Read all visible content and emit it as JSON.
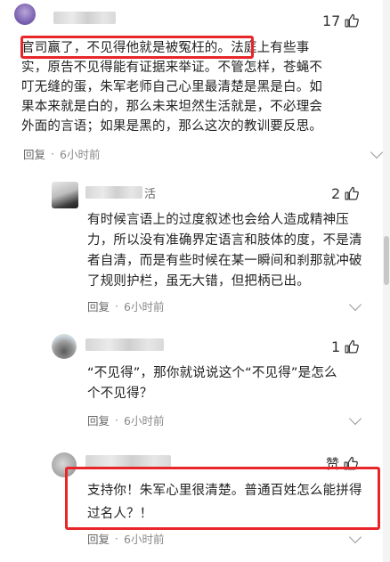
{
  "comments": [
    {
      "likes": "17",
      "text_lines": [
        "官司赢了，不见得他就是被冤枉的。法庭上有些事",
        "实，原告不见得能有证据来举证。不管怎样，苍蝇不",
        "叮无缝的蛋，朱军老师自己心里最清楚是黑是白。如",
        "果本来就是白的，那么未来坦然生活就是，不必理会",
        "外面的言语；如果是黑的，那么这次的教训要反思。"
      ],
      "reply_label": "回复",
      "time": "6小时前"
    },
    {
      "likes": "2",
      "name_fragment": "活",
      "text_lines": [
        "有时候言语上的过度叙述也会给人造成精神压",
        "力，所以没有准确界定语言和肢体的度，不是清",
        "者自清，而是有些时候在某一瞬间和刹那就冲破",
        "了规则护栏，虽无大错，但把柄已出。"
      ],
      "reply_label": "回复",
      "time": "6小时前"
    },
    {
      "likes": "1",
      "text_lines": [
        "“不见得”，那你就说说这个“不见得”是怎么",
        "个不见得？"
      ],
      "reply_label": "回复",
      "time": "6小时前"
    },
    {
      "likes": "赞",
      "text_lines": [
        "支持你！朱军心里很清楚。普通百姓怎么能拼得",
        "过名人？！"
      ],
      "reply_label": "回复",
      "time": "6小时前"
    }
  ],
  "separator": "·",
  "colors": {
    "highlight": "#e8262a",
    "meta": "#8a8a8a",
    "text": "#222222"
  },
  "icons": {
    "like": "thumbs-up-icon",
    "more": "chevron-down-icon"
  }
}
